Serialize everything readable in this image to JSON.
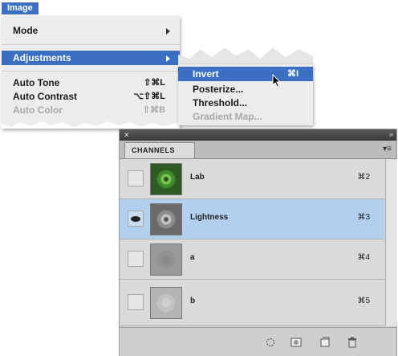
{
  "menubar": {
    "title": "Image"
  },
  "image_menu": {
    "items": [
      {
        "label": "Mode",
        "shortcut": ""
      },
      {
        "label": "Adjustments",
        "shortcut": ""
      },
      {
        "label": "Auto Tone",
        "shortcut": "⇧⌘L"
      },
      {
        "label": "Auto Contrast",
        "shortcut": "⌥⇧⌘L"
      },
      {
        "label": "Auto Color",
        "shortcut": "⇧⌘B"
      }
    ]
  },
  "adjustments_submenu": {
    "items": [
      {
        "label": "Invert",
        "shortcut": "⌘I"
      },
      {
        "label": "Posterize..."
      },
      {
        "label": "Threshold..."
      },
      {
        "label": "Gradient Map..."
      }
    ]
  },
  "channels_panel": {
    "tab": "CHANNELS",
    "channels": [
      {
        "name": "Lab",
        "shortcut": "⌘2",
        "visible": false,
        "selected": false
      },
      {
        "name": "Lightness",
        "shortcut": "⌘3",
        "visible": true,
        "selected": true
      },
      {
        "name": "a",
        "shortcut": "⌘4",
        "visible": false,
        "selected": false
      },
      {
        "name": "b",
        "shortcut": "⌘5",
        "visible": false,
        "selected": false
      }
    ]
  },
  "colors": {
    "accent": "#3b6fc4",
    "selected_row": "#b3cfee"
  },
  "icons": [
    "eye-icon",
    "load-selection-icon",
    "save-selection-icon",
    "new-channel-icon",
    "trash-icon",
    "mouse-pointer-icon"
  ]
}
